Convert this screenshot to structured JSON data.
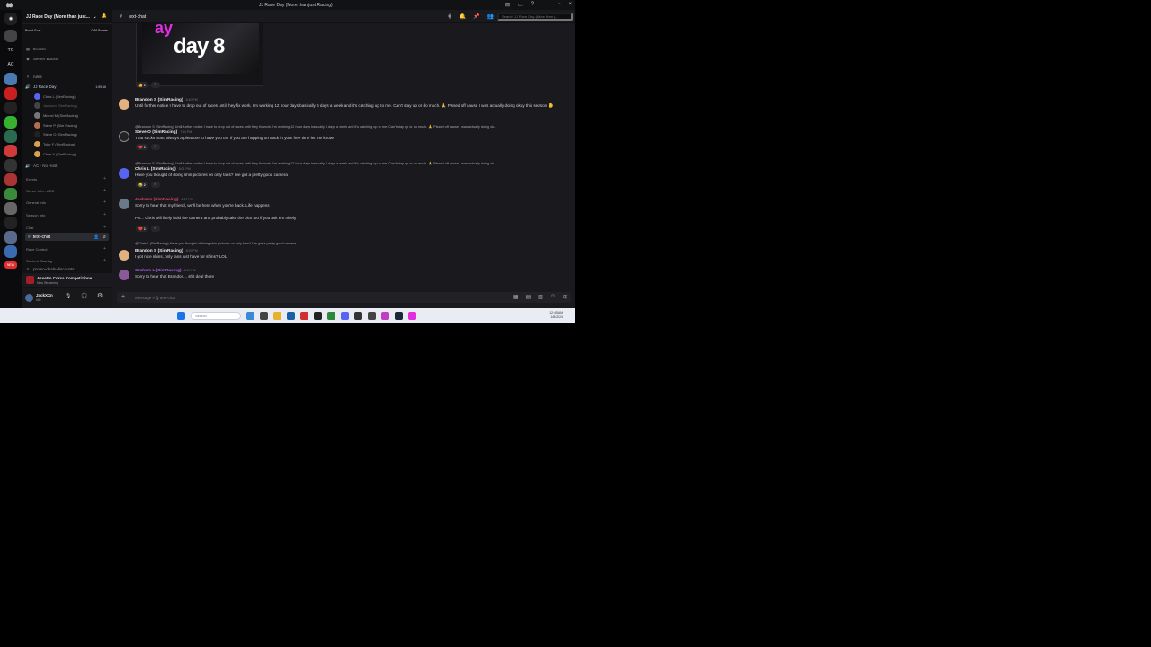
{
  "window": {
    "title": "JJ Race Day (More than just Racing)"
  },
  "server": {
    "name": "JJ Race Day (More than just...",
    "boost_goal": "Boost Goal",
    "boost_count": "0/26 Boosts",
    "events": "Events",
    "server_boosts": "Server Boosts"
  },
  "channels": {
    "rules": "rules",
    "voice": "JJ Race Day",
    "voice_time": "1:59:16",
    "members": [
      "Chris L (SimRacing)",
      "Jackson (SimRacing)",
      "Michel M (SimRacing)",
      "Steve P (Sim Racing)",
      "Steve O (SimRacing)",
      "Tyler F (SimRacing)",
      "Chris Y (SimRacing)"
    ],
    "ac_no_host": "AC - No Host",
    "categories": [
      "Events",
      "Server Info - ACC",
      "General Info",
      "Season Info",
      "Chat"
    ],
    "active_channel": "text-chat",
    "race_control": "Race Control",
    "content_sharing": "Content Sharing",
    "promo": "promo-deals-discounts"
  },
  "game_status": {
    "game": "Assetto Corsa Competizione",
    "state": "Now Streaming"
  },
  "user": {
    "name": "JackXXn",
    "status": "Idle"
  },
  "guild_labels": {
    "tc": "TC",
    "ac": "AC",
    "new": "NEW"
  },
  "chat": {
    "channel": "text-chat",
    "search_placeholder": "Search JJ Race Day (More than j...",
    "embed_big": "day 8",
    "embed_pink": "ay",
    "reaction_first": "1",
    "messages": [
      {
        "author": "Brandon S (SimRacing)",
        "time": "6:40 PM",
        "text": "Until further notice I have to drop out of races until they fix work. I'm working 12 hour days basically 6 days a week and it's catching up to me. Can't stay up or do much. 🙏 Pissed off cause I was actually doing okay this season 😕"
      },
      {
        "reply": "@Brandon S (SimRacing) Until further notice I have to drop out of races until they fix work. I'm working 12 hour days basically 6 days a week and it's catching up to me. Can't stay up or do much. 🙏 Pissed off cause I was actually doing ok...",
        "author": "Steve O (SimRacing)",
        "time": "7:44 PM",
        "text": "That sucks man, always a pleasure to have you on! If you are hopping on track in your free time let me know!",
        "reaction": "1"
      },
      {
        "reply": "@Brandon S (SimRacing) Until further notice I have to drop out of races until they fix work. I'm working 12 hour days basically 6 days a week and it's catching up to me. Can't stay up or do much. 🙏 Pissed off cause I was actually doing ok...",
        "author": "Chris L (SimRacing)",
        "time": "8:01 PM",
        "text": "Have you thought of doing shin pictures on only fans? I've got a pretty good camera",
        "reaction": "2"
      },
      {
        "author": "Jackson (SimRacing)",
        "time": "8:07 PM",
        "text": "Sorry to hear that my friend, we'll be here when you're back. Life happens",
        "text2": "PS... Chris will likely hold the camera and probably take the pics too if you ask em nicely",
        "reaction": "1"
      },
      {
        "reply": "@Chris L (SimRacing) Have you thought of doing shin pictures on only fans? I've got a pretty good camera",
        "author": "Brandon S (SimRacing)",
        "time": "8:20 PM",
        "text": "I got nice shins, only fans just have for shins? LOL"
      },
      {
        "author": "Graham L (SimRacing)",
        "time": "8:37 PM",
        "text": "Sorry to hear that Brandon... shit deal there"
      }
    ],
    "composer_placeholder": "Message #🎙text-chat"
  },
  "taskbar": {
    "search": "Search",
    "time": "12:45 AM",
    "date": "1/8/2024"
  },
  "colors": {
    "accent": "#5865f2",
    "jackson_name": "#e0466a",
    "graham_name": "#a065e0"
  }
}
